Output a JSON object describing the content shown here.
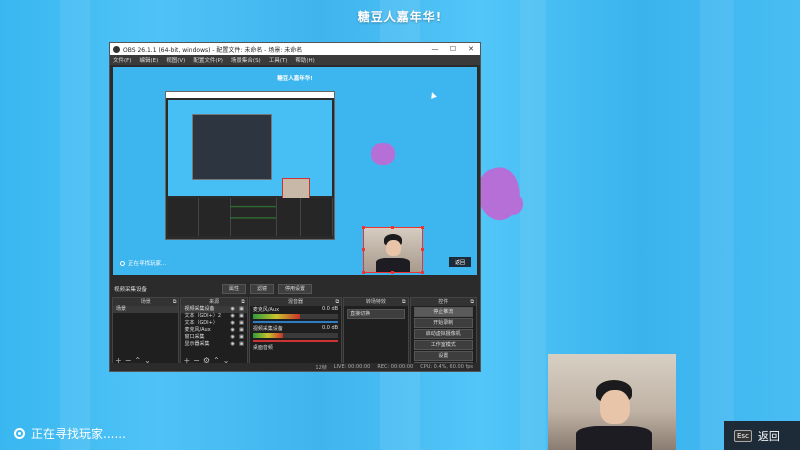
{
  "game": {
    "title": "糖豆人嘉年华!",
    "status_text": "正在寻找玩家......",
    "back_key": "Esc",
    "back_label": "返回"
  },
  "obs": {
    "window_title": "OBS 26.1.1 (64-bit, windows) - 配置文件: 未命名 - 场景: 未命名",
    "window_controls": [
      "—",
      "☐",
      "✕"
    ],
    "menu": [
      "文件(F)",
      "编辑(E)",
      "视图(V)",
      "配置文件(P)",
      "场景集合(S)",
      "工具(T)",
      "帮助(H)"
    ],
    "preview": {
      "title": "糖豆人嘉年华!",
      "status_text": "正在寻找玩家...",
      "back_label": "返回"
    },
    "source_bar": {
      "selected_source": "视频采集设备",
      "properties": "属性",
      "filters": "滤镜",
      "deactivate": "停用设置"
    },
    "docks": {
      "scenes": {
        "title": "场景",
        "items": [
          "场景"
        ]
      },
      "sources": {
        "title": "来源",
        "items": [
          "视频采集设备",
          "文本（GDI+）2",
          "文本（GDI+）",
          "麦克风/Aux",
          "窗口采集",
          "显示器采集"
        ]
      },
      "mixer": {
        "title": "混音器",
        "channels": [
          {
            "name": "麦克风/Aux",
            "db": "0.0 dB",
            "level": 0.55
          },
          {
            "name": "视频采集设备",
            "db": "0.0 dB",
            "level": 0.35
          },
          {
            "name": "桌面音频",
            "db": "",
            "level": 0.0
          }
        ]
      },
      "transitions": {
        "title": "转场特效",
        "value": "直接切换"
      },
      "controls": {
        "title": "控件",
        "buttons": [
          "停止推流",
          "开始录制",
          "启动虚拟摄像机",
          "工作室模式",
          "设置",
          "退出"
        ]
      }
    },
    "statusbar": {
      "dropped": "12帧",
      "live": "LIVE: 00:00:00",
      "rec": "REC: 00:00:00",
      "cpu": "CPU: 0.4%, 60.00 fps"
    }
  },
  "colors": {
    "accent_bg": "#3db6f0",
    "obs_dark": "#2b2b2b",
    "recording_red": "#e33333"
  }
}
